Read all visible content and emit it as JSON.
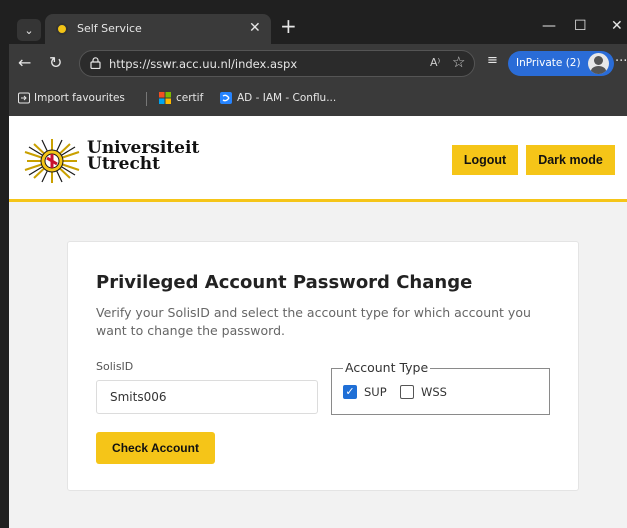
{
  "browser": {
    "tab": {
      "title": "Self Service",
      "close": "✕"
    },
    "new_tab": "+",
    "window": {
      "minimize": "—",
      "maximize": "☐",
      "close": "✕"
    },
    "url": "https://sswr.acc.uu.nl/index.aspx",
    "read_aloud": "A⁾",
    "inprivate_label": "InPrivate (2)",
    "more": "···",
    "bookmarks": [
      {
        "label": "Import favourites"
      },
      {
        "label": "certif"
      },
      {
        "label": "AD - IAM - Conflu..."
      }
    ]
  },
  "header": {
    "logo_line1": "Universiteit",
    "logo_line2": "Utrecht",
    "logout_label": "Logout",
    "darkmode_label": "Dark mode"
  },
  "form": {
    "title": "Privileged Account Password Change",
    "description": "Verify your SolisID and select the account type for which account you want to change the password.",
    "solis_label": "SolisID",
    "solis_value": "Smits006",
    "account_type_legend": "Account Type",
    "options": [
      {
        "label": "SUP",
        "checked": true
      },
      {
        "label": "WSS",
        "checked": false
      }
    ],
    "check_button": "Check Account"
  },
  "colors": {
    "accent": "#f5c518",
    "inprivate": "#2a6cd7",
    "checkbox": "#1f6fd6"
  }
}
